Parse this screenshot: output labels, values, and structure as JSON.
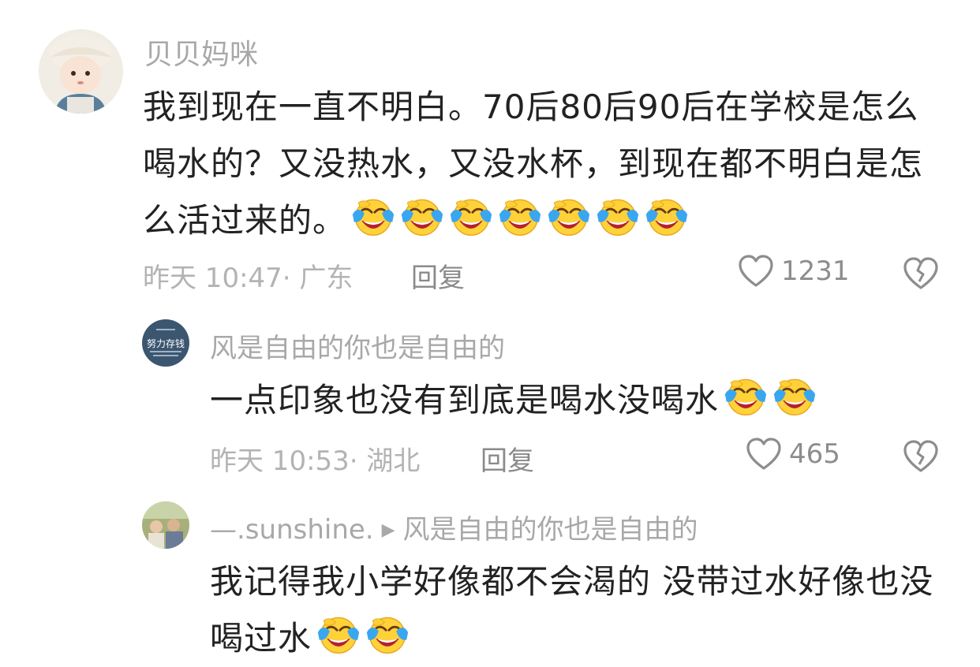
{
  "comments": [
    {
      "username": "贝贝妈咪",
      "text": "我到现在一直不明白。70后80后90后在学校是怎么喝水的？又没热水，又没水杯，到现在都不明白是怎么活过来的。",
      "emoji_icons": [
        "laughing-crying-emoji",
        "laughing-crying-emoji",
        "laughing-crying-emoji",
        "laughing-crying-emoji",
        "laughing-crying-emoji",
        "laughing-crying-emoji",
        "laughing-crying-emoji"
      ],
      "time_location": "昨天 10:47· 广东",
      "reply_label": "回复",
      "like_count": "1231"
    },
    {
      "username": "风是自由的你也是自由的",
      "avatar_text": "努力存钱",
      "text": "一点印象也没有到底是喝水没喝水",
      "emoji_icons": [
        "laughing-crying-emoji",
        "laughing-crying-emoji"
      ],
      "time_location": "昨天 10:53· 湖北",
      "reply_label": "回复",
      "like_count": "465"
    },
    {
      "username": "—.sunshine.",
      "reply_to": "风是自由的你也是自由的",
      "text": "我记得我小学好像都不会渴的 没带过水好像也没喝过水",
      "emoji_icons": [
        "laughing-crying-emoji",
        "laughing-crying-emoji"
      ]
    }
  ],
  "colors": {
    "text": "#222222",
    "username": "#a8a8a8",
    "meta": "#b3b3b3",
    "emoji_face": "#ffd23a",
    "emoji_tear": "#3aa6f0"
  }
}
